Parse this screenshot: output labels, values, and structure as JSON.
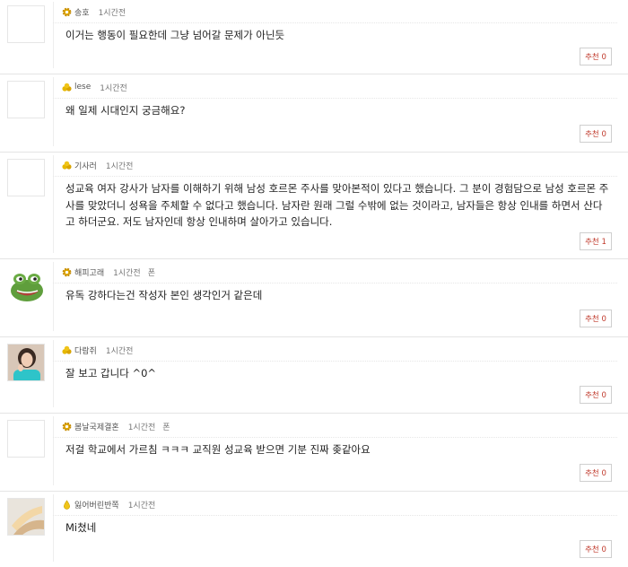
{
  "comments": [
    {
      "nick": "송호",
      "time": "1시간전",
      "extra": "",
      "text": "이거는 행동이 필요한데 그냥 넘어갈 문제가 아닌듯",
      "rec": "추천 0",
      "badge": "gear",
      "avatar": "blank"
    },
    {
      "nick": "lese",
      "time": "1시간전",
      "extra": "",
      "text": "왜 일제 시대인지 궁금해요?",
      "rec": "추천 0",
      "badge": "medal",
      "avatar": "blank"
    },
    {
      "nick": "기사러",
      "time": "1시간전",
      "extra": "",
      "text": "성교육 여자 강사가 남자를 이해하기 위해 남성 호르몬 주사를 맞아본적이 있다고 했습니다. 그 분이 경험담으로 남성 호르몬 주사를 맞았더니 성욕을 주체할 수 없다고 했습니다. 남자란 원래 그럴 수밖에 없는 것이라고, 남자들은 항상 인내를 하면서 산다고 하더군요. 저도 남자인데 항상 인내하며 살아가고 있습니다.",
      "rec": "추천 1",
      "badge": "medal",
      "avatar": "blank"
    },
    {
      "nick": "해피고래",
      "time": "1시간전",
      "extra": "폰",
      "text": "유독 강하다는건 작성자 본인 생각인거 같은데",
      "rec": "추천 0",
      "badge": "gear",
      "avatar": "frog"
    },
    {
      "nick": "다람쥐",
      "time": "1시간전",
      "extra": "",
      "text": "잘 보고 갑니다 ^0^",
      "rec": "추천 0",
      "badge": "medal",
      "avatar": "photo"
    },
    {
      "nick": "봄날국제결혼",
      "time": "1시간전",
      "extra": "폰",
      "text": "저걸 학교에서 가르침 ㅋㅋㅋ 교직원 성교육 받으면 기분 진짜 좆같아요",
      "rec": "추천 0",
      "badge": "gear",
      "avatar": "blank"
    },
    {
      "nick": "잃어버린반쪽",
      "time": "1시간전",
      "extra": "",
      "text": "Mi쳤네",
      "rec": "추천 0",
      "badge": "drop",
      "avatar": "photo2"
    }
  ]
}
